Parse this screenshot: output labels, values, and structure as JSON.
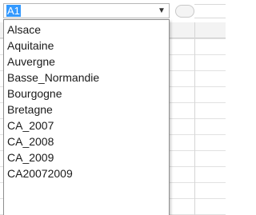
{
  "name_box": {
    "value": "A1"
  },
  "dropdown": {
    "items": [
      {
        "label": "Alsace"
      },
      {
        "label": "Aquitaine"
      },
      {
        "label": "Auvergne"
      },
      {
        "label": "Basse_Normandie"
      },
      {
        "label": "Bourgogne"
      },
      {
        "label": "Bretagne"
      },
      {
        "label": "CA_2007"
      },
      {
        "label": "CA_2008"
      },
      {
        "label": "CA_2009"
      },
      {
        "label": "CA20072009"
      }
    ]
  },
  "icons": {
    "name_box_dropdown": "chevron-down-icon"
  },
  "colors": {
    "selection": "#3399ff",
    "gridline": "#e1e1e1"
  }
}
